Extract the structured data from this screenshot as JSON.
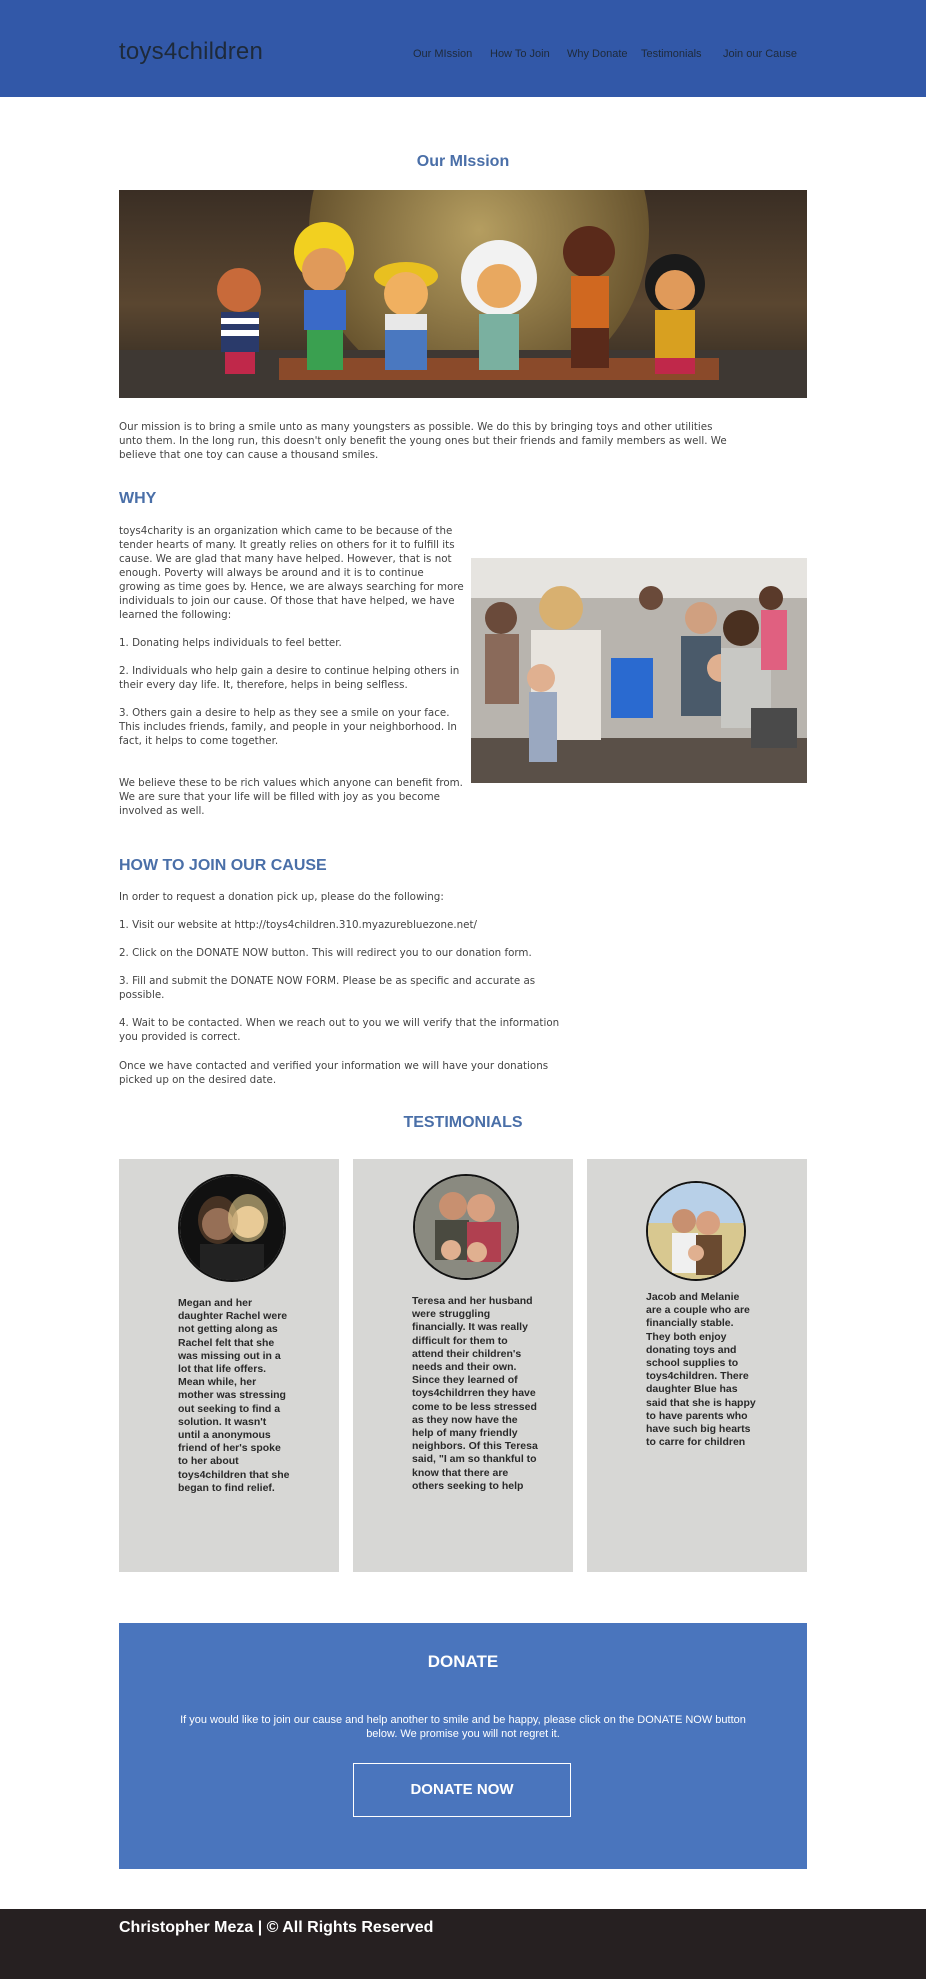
{
  "header": {
    "logo": "toys4children",
    "nav": [
      "Our MIssion",
      "How To Join",
      "Why Donate",
      "Testimonials",
      "Join our Cause"
    ]
  },
  "mission": {
    "title": "Our MIssion",
    "text": "Our mission is to bring a smile unto as many youngsters as possible. We do this by bringing toys and other utilities unto them. In the long run, this doesn't only benefit the young ones but their friends and family members as well. We believe that one toy can cause a thousand smiles."
  },
  "why": {
    "title": "WHY",
    "intro": "toys4charity is an organization which came to be because of the tender hearts of many. It greatly relies on others for it to fulfill its cause. We are glad that many have helped. However, that is not enough. Poverty will always be around and it is to continue growing as time goes by. Hence, we are always searching for more individuals to join our cause. Of those that have helped, we have learned the following:",
    "points": [
      "1. Donating helps individuals to feel better.",
      "2. Individuals who help gain a desire to continue helping others in their every day life. It, therefore, helps in being selfless.",
      "3. Others gain a desire to help as they see a smile on your face. This includes friends, family, and people in your neighborhood. In fact, it helps to come together."
    ],
    "closing": "We believe these to be rich values which anyone can benefit from. We are sure that your life will be filled with joy as you become involved as well."
  },
  "join": {
    "title": "HOW TO JOIN OUR CAUSE",
    "intro": "In order to request a donation pick up, please do the following:",
    "steps": [
      "1. Visit our website at http://toys4children.310.myazurebluezone.net/",
      "2. Click on the DONATE NOW button. This will redirect you to our donation form.",
      "3. Fill and submit the DONATE NOW FORM. Please be as specific and accurate as possible.",
      "4. Wait to be contacted. When we reach out to you we will verify that the information you provided is correct."
    ],
    "closing": "Once we have contacted and verified your information we will have your donations picked up on the desired date."
  },
  "testimonials": {
    "title": "TESTIMONIALS",
    "items": [
      "Megan and her daughter Rachel were not getting along as Rachel felt that she was missing out in a lot that life offers. Mean while, her mother was stressing out seeking to find a solution. It wasn't until a anonymous friend of her's spoke to her about toys4children that she began to find relief.",
      "Teresa and her husband were struggling financially. It was really difficult for them to attend their children's needs and their own. Since they learned of toys4childrren they have come to be less stressed as they now have the help of many friendly neighbors. Of this Teresa said, \"I am so thankful to know that there are others seeking to help",
      "Jacob and Melanie are a couple who are financially stable. They both enjoy donating toys and school supplies to toys4children. There daughter Blue has said that she is happy to have parents who have such big hearts to carre for children"
    ]
  },
  "donate": {
    "title": "DONATE",
    "text": "If you would like to join our cause and help another to smile and be happy, please click on the DONATE NOW button below. We promise you will not regret it.",
    "button": "DONATE NOW"
  },
  "footer": {
    "text": "Christopher Meza | © All Rights Reserved"
  }
}
